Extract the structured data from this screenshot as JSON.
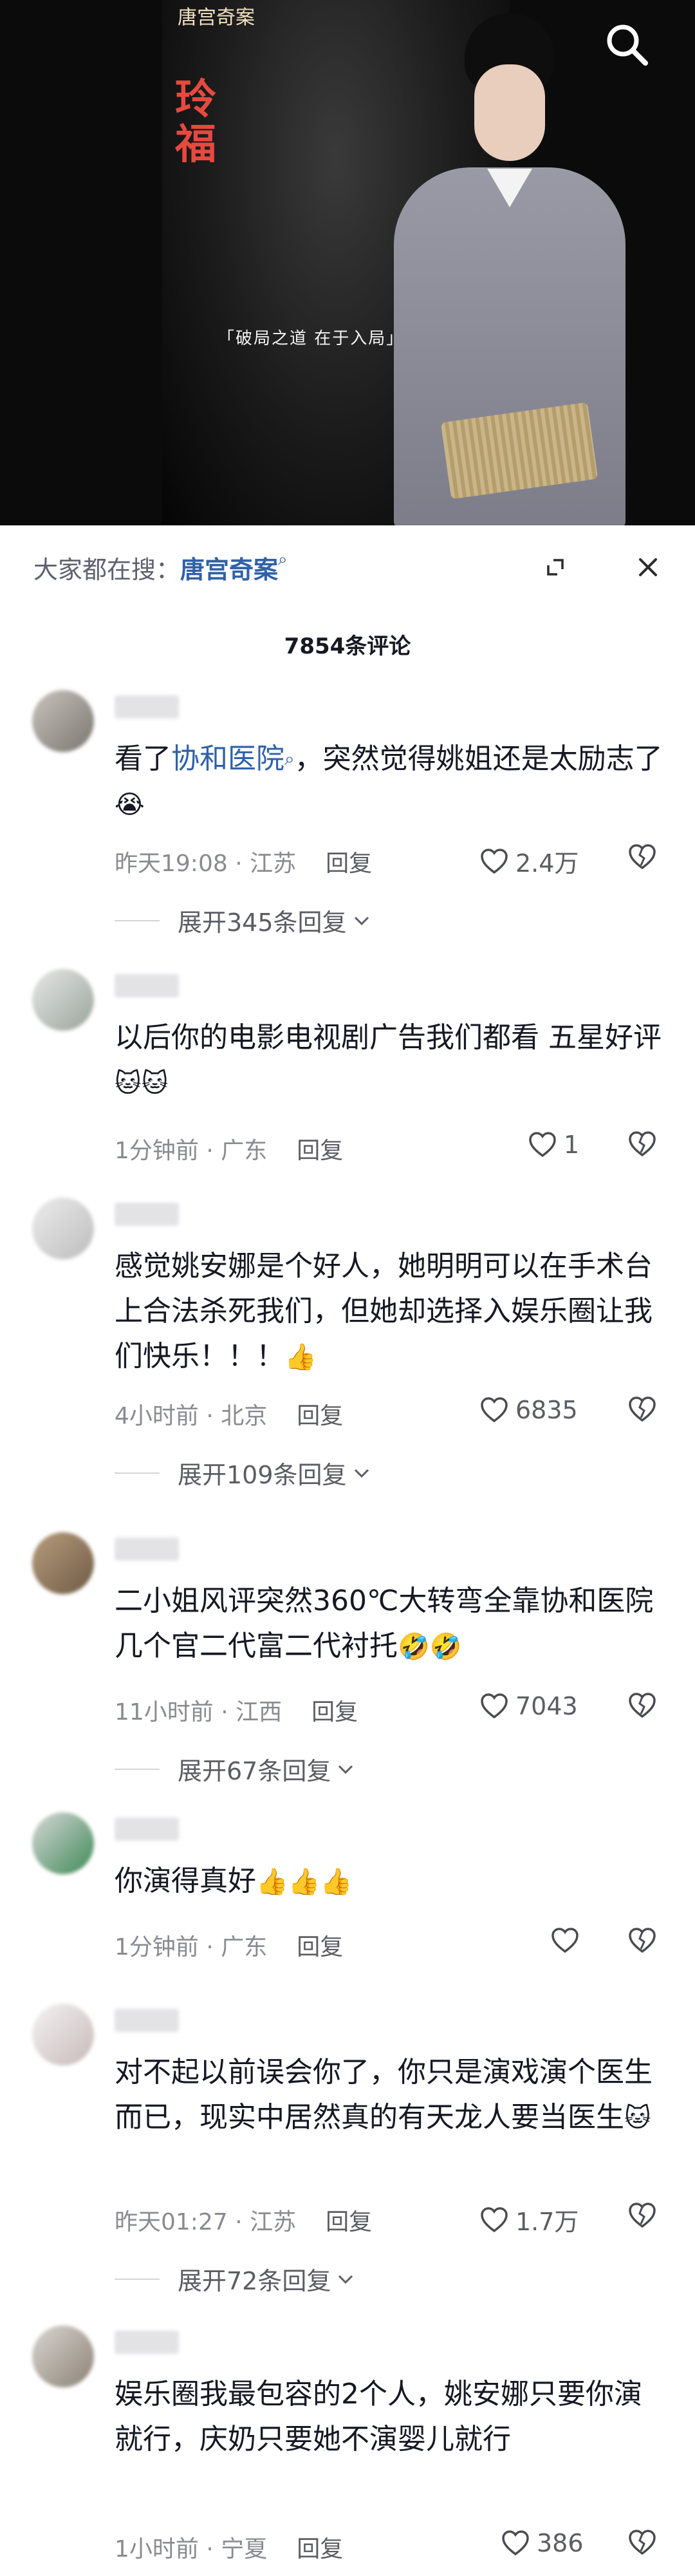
{
  "video": {
    "brand": "唐宫奇案",
    "title_vertical": "玲 福",
    "banner": "「破局之道 在于入局」"
  },
  "sheet": {
    "hot_search_prefix": "大家都在搜：",
    "hot_search_query": "唐宫奇案",
    "comment_count": "7854条评论"
  },
  "comments": [
    {
      "text_before": "看了",
      "link": "协和医院",
      "text_after": "，突然觉得姚姐还是太励志了",
      "emoji": "😭",
      "time": "昨天19:08",
      "location": "江苏",
      "reply_label": "回复",
      "likes": "2.4万",
      "expand": "展开345条回复"
    },
    {
      "text": "以后你的电影电视剧广告我们都看 五星好评",
      "emoji": "🐱🐱",
      "time": "1分钟前",
      "location": "广东",
      "reply_label": "回复",
      "likes": "1",
      "expand": ""
    },
    {
      "text": "感觉姚安娜是个好人，她明明可以在手术台上合法杀死我们，但她却选择入娱乐圈让我们快乐！！！",
      "emoji": "👍",
      "time": "4小时前",
      "location": "北京",
      "reply_label": "回复",
      "likes": "6835",
      "expand": "展开109条回复"
    },
    {
      "text": "二小姐风评突然360℃大转弯全靠协和医院几个官二代富二代衬托",
      "emoji": "🤣🤣",
      "time": "11小时前",
      "location": "江西",
      "reply_label": "回复",
      "likes": "7043",
      "expand": "展开67条回复"
    },
    {
      "text": "你演得真好",
      "emoji": "👍👍👍",
      "time": "1分钟前",
      "location": "广东",
      "reply_label": "回复",
      "likes": "",
      "expand": ""
    },
    {
      "text": "对不起以前误会你了，你只是演戏演个医生而已，现实中居然真的有天龙人要当医生",
      "emoji": "🐱",
      "time": "昨天01:27",
      "location": "江苏",
      "reply_label": "回复",
      "likes": "1.7万",
      "expand": "展开72条回复"
    },
    {
      "text": "娱乐圈我最包容的2个人，姚安娜只要你演就行，庆奶只要她不演婴儿就行",
      "emoji": "",
      "time": "1小时前",
      "location": "宁夏",
      "reply_label": "回复",
      "likes": "386",
      "expand": ""
    }
  ],
  "colors": {
    "link": "#2f61a8",
    "meta": "#8a8b91",
    "text": "#161823"
  }
}
